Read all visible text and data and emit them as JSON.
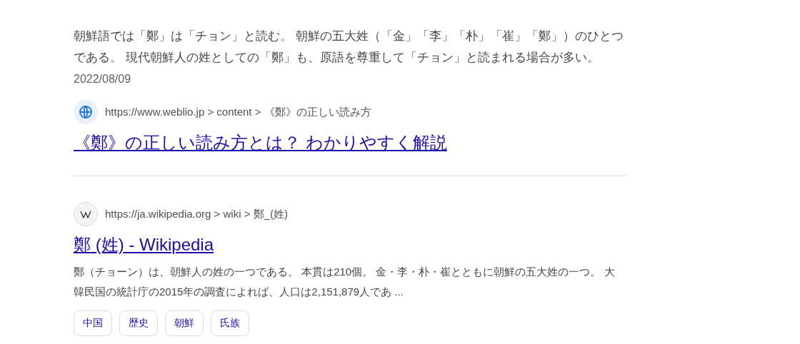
{
  "results": [
    {
      "kind": "snippet",
      "snippet": "朝鮮語では「鄭」は「チョン」と読む。 朝鮮の五大姓（「金」「李」「朴」「崔」「鄭」）のひとつである。 現代朝鮮人の姓としての「鄭」も、原語を尊重して「チョン」と読まれる場合が多い。",
      "date": "2022/08/09"
    },
    {
      "kind": "web",
      "url": "https://www.weblio.jp > content > 《鄭》の正しい読み方",
      "title": "《鄭》の正しい読み方とは？ わかりやすく解説"
    },
    {
      "kind": "wiki",
      "url": "https://ja.wikipedia.org > wiki > 鄭_(姓)",
      "title": "鄭 (姓) - Wikipedia",
      "description": "鄭（チョーン）は、朝鮮人の姓の一つである。 本貫は210個。 金・李・朴・崔とともに朝鮮の五大姓の一つ。 大韓民国の統計庁の2015年の調査によれば、人口は2,151,879人であ ...",
      "tags": [
        "中国",
        "歴史",
        "朝鮮",
        "氏族"
      ]
    }
  ]
}
